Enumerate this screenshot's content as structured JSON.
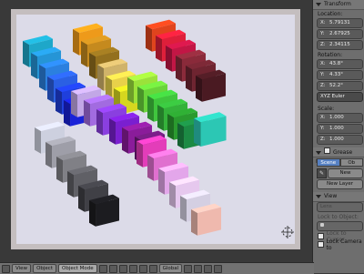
{
  "properties": {
    "transform": {
      "title": "Transform",
      "location_label": "Location:",
      "location": [
        {
          "axis": "X:",
          "value": "5.79131"
        },
        {
          "axis": "Y:",
          "value": "2.67925"
        },
        {
          "axis": "Z:",
          "value": "2.34115"
        }
      ],
      "rotation_label": "Rotation:",
      "rotation": [
        {
          "axis": "X:",
          "value": "43.8°"
        },
        {
          "axis": "Y:",
          "value": "4.33°"
        },
        {
          "axis": "Z:",
          "value": "52.2°"
        }
      ],
      "rotation_mode": "XYZ Euler",
      "scale_label": "Scale:",
      "scale": [
        {
          "axis": "X:",
          "value": "1.000"
        },
        {
          "axis": "Y:",
          "value": "1.000"
        },
        {
          "axis": "Z:",
          "value": "1.000"
        }
      ]
    },
    "grease_pencil": {
      "title": "Grease Penc",
      "tabs": [
        "Scene",
        "Ob"
      ],
      "active_tab": "Scene",
      "new_button": "New",
      "new_layer_button": "New Layer"
    },
    "view": {
      "title": "View",
      "lens_label": "Lens",
      "lock_to_object": "Lock to Object:",
      "lock_to_cursor": "Lock to Cursor",
      "lock_camera": "Lock Camera to"
    }
  },
  "header": {
    "view_menu": "View",
    "object_menu": "Object",
    "mode": "Object Mode",
    "pivot": "Global"
  },
  "viewport": {
    "background": "#393939",
    "frame_color": "#c4bebf",
    "floor_color": "#dcdbe8"
  }
}
